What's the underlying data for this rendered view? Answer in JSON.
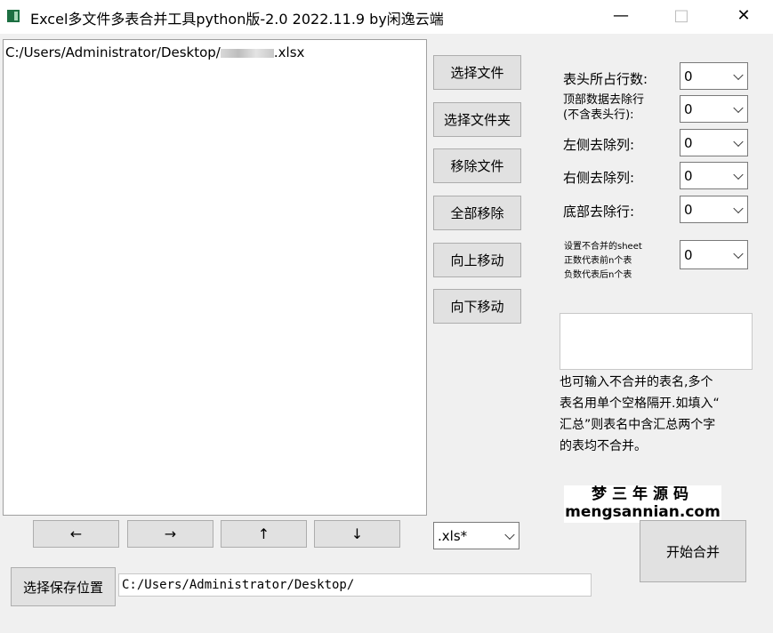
{
  "window": {
    "title": "Excel多文件多表合并工具python版-2.0 2022.11.9 by闲逸云端",
    "minimize": "—",
    "maximize": "□",
    "close": "✕"
  },
  "file_list": {
    "items": [
      {
        "prefix": "C:/Users/Administrator/Desktop/",
        "suffix": ".xlsx"
      }
    ]
  },
  "buttons": {
    "select_file": "选择文件",
    "select_folder": "选择文件夹",
    "remove_file": "移除文件",
    "remove_all": "全部移除",
    "move_up": "向上移动",
    "move_down": "向下移动",
    "arrow_left": "←",
    "arrow_right": "→",
    "arrow_up": "↑",
    "arrow_down": "↓",
    "start_merge": "开始合并",
    "choose_save": "选择保存位置"
  },
  "options": {
    "header_rows_label": "表头所占行数:",
    "header_rows_value": "0",
    "top_remove_label_1": "顶部数据去除行",
    "top_remove_label_2": "(不含表头行):",
    "top_remove_value": "0",
    "left_remove_label": "左侧去除列:",
    "left_remove_value": "0",
    "right_remove_label": "右侧去除列:",
    "right_remove_value": "0",
    "bottom_remove_label": "底部去除行:",
    "bottom_remove_value": "0",
    "sheet_exclude_label_1": "设置不合并的sheet",
    "sheet_exclude_label_2": "正数代表前n个表",
    "sheet_exclude_label_3": "负数代表后n个表",
    "sheet_exclude_value": "0"
  },
  "hint": {
    "line1": "也可输入不合并的表名,多个",
    "line2": "表名用单个空格隔开.如填入“",
    "line3": "汇总”则表名中含汇总两个字",
    "line4": "的表均不合并。"
  },
  "watermark": {
    "top": "梦三年源码",
    "bottom": "mengsannian.com"
  },
  "file_type": {
    "value": ".xls*"
  },
  "save_path": {
    "value": "C:/Users/Administrator/Desktop/"
  }
}
